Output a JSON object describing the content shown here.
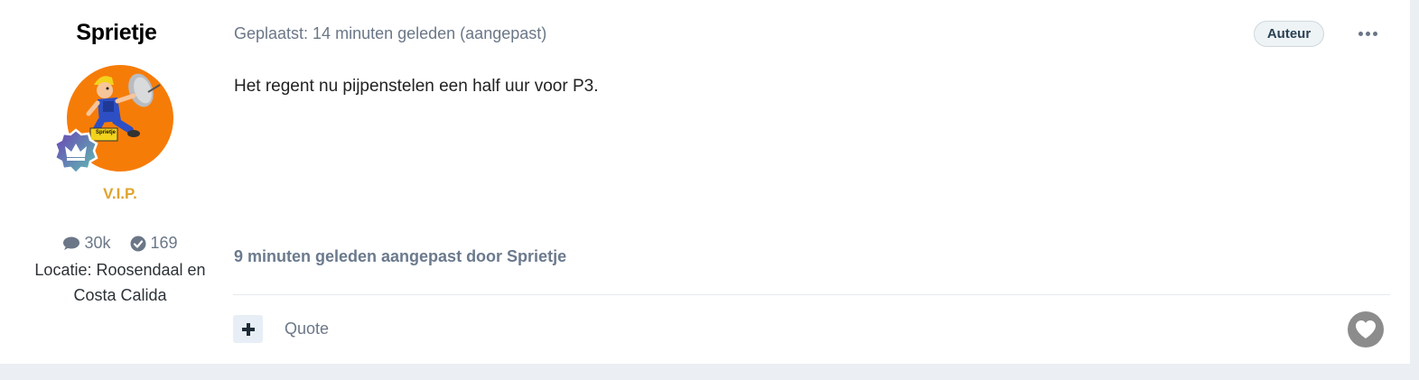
{
  "author": {
    "name": "Sprietje",
    "rank": "V.I.P.",
    "posts_count": "30k",
    "reputation": "169",
    "location": "Locatie: Roosendaal en Costa Calida",
    "avatar_label": "Sprietje",
    "avatar_bg": "#f67c08",
    "badge_icon": "crown-badge-icon"
  },
  "post": {
    "meta": "Geplaatst: 14 minuten geleden (aangepast)",
    "author_badge": "Auteur",
    "text": "Het regent nu pijpenstelen een half uur voor P3.",
    "edited_note": "9 minuten geleden aangepast door Sprietje"
  },
  "actions": {
    "quote_label": "Quote",
    "multiquote_icon": "plus-icon",
    "like_icon": "heart-icon",
    "menu_icon": "more-dots-icon"
  },
  "colors": {
    "rank": "#dfa42e",
    "muted": "#6b7787",
    "background": "#ebeef2"
  }
}
